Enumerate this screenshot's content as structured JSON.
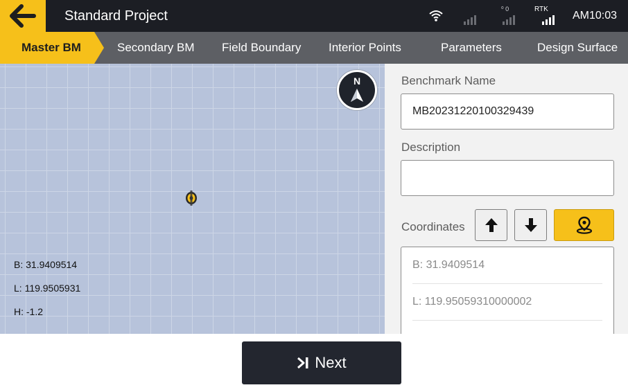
{
  "header": {
    "title": "Standard Project",
    "status": {
      "signal2_label": "⁰ 0",
      "rtk_label": "RTK",
      "time": "AM10:03"
    }
  },
  "tabs": [
    {
      "label": "Master BM",
      "active": true
    },
    {
      "label": "Secondary BM"
    },
    {
      "label": "Field Boundary"
    },
    {
      "label": "Interior Points"
    },
    {
      "label": "Parameters"
    },
    {
      "label": "Design Surface"
    }
  ],
  "map": {
    "compass_label": "N",
    "readout": {
      "b": "B: 31.9409514",
      "l": "L: 119.9505931",
      "h": "H: -1.2"
    }
  },
  "form": {
    "benchmark_name_label": "Benchmark Name",
    "benchmark_name_value": "MB20231220100329439",
    "description_label": "Description",
    "description_value": "",
    "coordinates_label": "Coordinates",
    "coordinates": {
      "b": "B: 31.9409514",
      "l": "L: 119.95059310000002"
    }
  },
  "footer": {
    "next_label": "Next"
  },
  "colors": {
    "accent": "#f6c01a",
    "topbar": "#1c1e24",
    "tabbar": "#5d5f64",
    "map": "#b7c3db"
  }
}
